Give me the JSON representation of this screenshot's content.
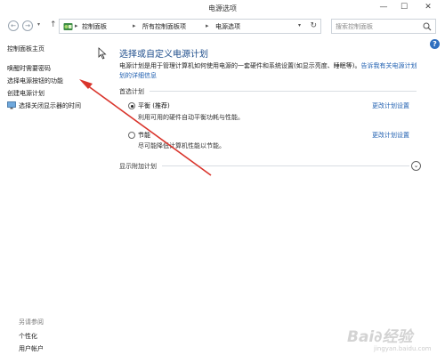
{
  "window": {
    "title": "电源选项",
    "min_glyph": "—",
    "max_glyph": "☐",
    "close_glyph": "✕"
  },
  "address": {
    "back_glyph": "←",
    "forward_glyph": "→",
    "dropdown_glyph": "▾",
    "up_glyph": "↑",
    "crumbs": [
      "控制面板",
      "所有控制面板项",
      "电源选项"
    ],
    "separator": "▸",
    "refresh_glyph": "↻",
    "search_placeholder": "搜索控制面板"
  },
  "help_glyph": "?",
  "sidebar": {
    "home": "控制面板主页",
    "items": [
      "唤醒时需要密码",
      "选择电源按钮的功能",
      "创建电源计划",
      "选择关闭显示器的时间"
    ],
    "see_also_label": "另请参阅",
    "see_also": [
      "个性化",
      "用户帐户"
    ]
  },
  "main": {
    "heading": "选择或自定义电源计划",
    "desc_line1": "电源计划是用于管理计算机如何使用电源的一套硬件和系统设置(如显示亮度、睡眠等)。",
    "desc_link_a": "告诉我有关电源计划",
    "desc_link_b": "划的详细信息",
    "preferred_label": "首选计划",
    "plans": [
      {
        "name": "平衡 (推荐)",
        "desc": "利用可用的硬件自动平衡功耗与性能。",
        "link": "更改计划设置",
        "selected": true
      },
      {
        "name": "节能",
        "desc": "尽可能降低计算机性能以节能。",
        "link": "更改计划设置",
        "selected": false
      }
    ],
    "additional_label": "显示附加计划",
    "expand_glyph": "⌄"
  },
  "annotation_color": "#d9342b",
  "watermark": {
    "brand": "Bai∂经验",
    "sub": "jingyan.baidu.com"
  }
}
